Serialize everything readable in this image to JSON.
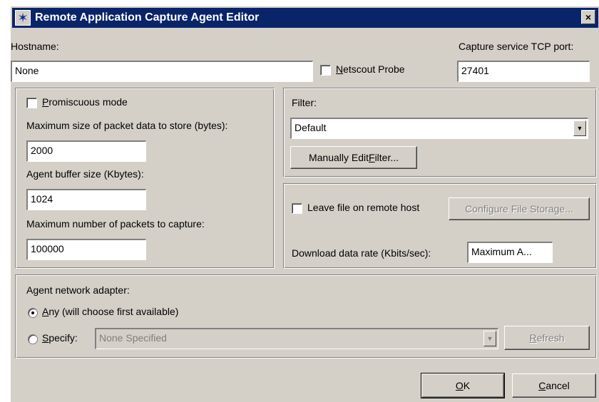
{
  "window": {
    "title": "Remote Application Capture Agent Editor",
    "close": "×"
  },
  "hostname": {
    "label": "Hostname:",
    "value": "None"
  },
  "netscout": {
    "label_u": "N",
    "label_rest": "etscout Probe"
  },
  "port": {
    "label": "Capture service TCP port:",
    "value": "27401"
  },
  "left_group": {
    "promisc_u": "P",
    "promisc_rest": "romiscuous mode",
    "max_size_label": "Maximum size of packet data to store (bytes):",
    "max_size_value": "2000",
    "buffer_label": "Agent buffer size (Kbytes):",
    "buffer_value": "1024",
    "max_packets_label": "Maximum number of packets to capture:",
    "max_packets_value": "100000"
  },
  "filter": {
    "label": "Filter:",
    "selected": "Default",
    "edit_btn_pre": "Manually Edit ",
    "edit_btn_u": "F",
    "edit_btn_post": "ilter..."
  },
  "storage": {
    "leave_label": "Leave file on remote host",
    "configure_btn": "Configure File Storage...",
    "rate_label": "Download data rate (Kbits/sec):",
    "rate_value": "Maximum A..."
  },
  "adapter": {
    "label": "Agent network adapter:",
    "any_u": "A",
    "any_rest": "ny (will choose first available)",
    "specify_u": "S",
    "specify_rest": "pecify:",
    "specify_value": "None Specified",
    "refresh_u": "R",
    "refresh_rest": "efresh"
  },
  "buttons": {
    "ok_u": "O",
    "ok_rest": "K",
    "cancel_u": "C",
    "cancel_rest": "ancel"
  },
  "icons": {
    "app": "star-icon",
    "dropdown": "chevron-down-icon"
  }
}
